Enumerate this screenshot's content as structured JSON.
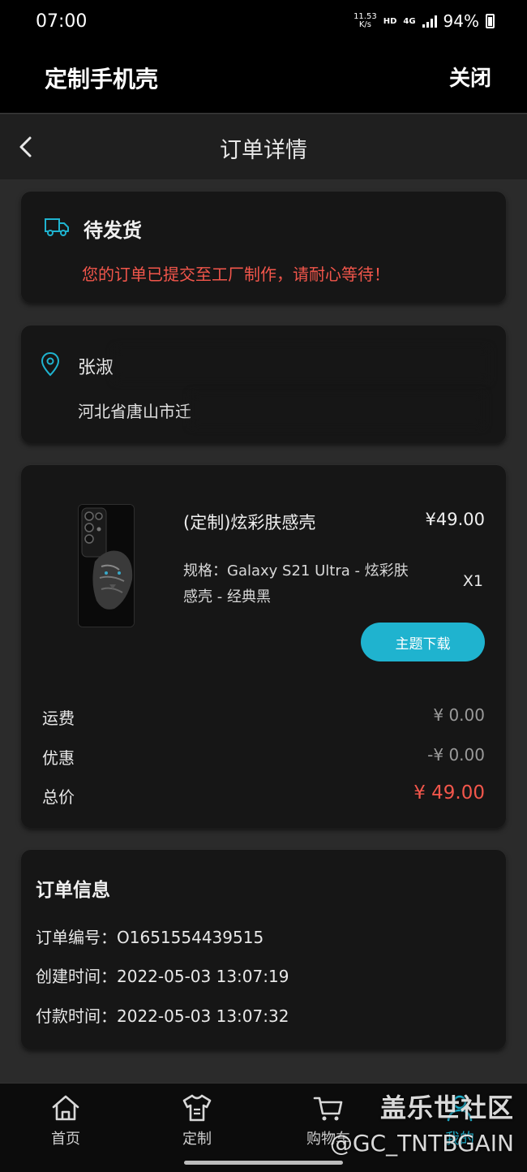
{
  "status_bar": {
    "time": "07:00",
    "net_speed_value": "11.53",
    "net_speed_unit": "K/s",
    "hd": "HD",
    "network": "4G",
    "battery": "94%"
  },
  "app_header": {
    "title": "定制手机壳",
    "close_label": "关闭"
  },
  "page": {
    "title": "订单详情"
  },
  "order_status": {
    "icon": "truck-icon",
    "title": "待发货",
    "message": "您的订单已提交至工厂制作，请耐心等待！"
  },
  "address": {
    "icon": "location-icon",
    "name": "张淑",
    "address": "河北省唐山市迁"
  },
  "product": {
    "name": "(定制)炫彩肤感壳",
    "price": "¥49.00",
    "spec_line1": "规格：Galaxy S21 Ultra - 炫彩肤",
    "spec_line2": "感壳 - 经典黑",
    "quantity": "X1",
    "download_label": "主题下载"
  },
  "fees": {
    "shipping_label": "运费",
    "shipping_value": "¥ 0.00",
    "discount_label": "优惠",
    "discount_value": "-¥ 0.00",
    "total_label": "总价",
    "total_value": "¥ 49.00"
  },
  "order_info": {
    "title": "订单信息",
    "number_label": "订单编号：",
    "number_value": "O1651554439515",
    "created_label": "创建时间：",
    "created_value": "2022-05-03 13:07:19",
    "paid_label": "付款时间：",
    "paid_value": "2022-05-03 13:07:32"
  },
  "bottom_nav": {
    "items": [
      {
        "label": "首页",
        "icon": "home-icon"
      },
      {
        "label": "定制",
        "icon": "tshirt-icon"
      },
      {
        "label": "购物车",
        "icon": "cart-icon"
      },
      {
        "label": "我的",
        "icon": "user-icon"
      }
    ]
  },
  "watermark": {
    "line1": "盖乐世社区",
    "line2": "@GC_TNTBGAIN"
  },
  "colors": {
    "accent": "#1fb3cf",
    "alert": "#f2564b",
    "background": "#2b2b2b",
    "card": "#161616"
  }
}
